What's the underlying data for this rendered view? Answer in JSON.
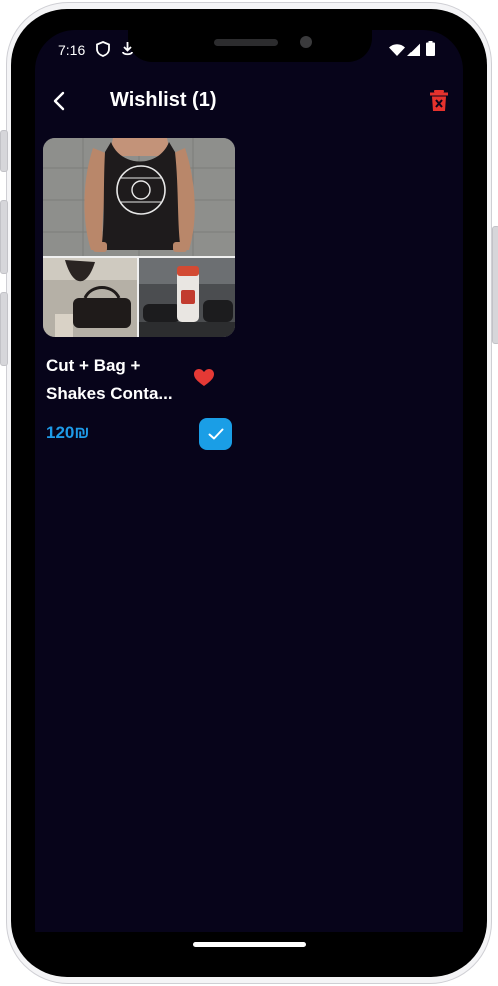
{
  "status_bar": {
    "time": "7:16",
    "left_icons": [
      "shield-icon",
      "download-notification-icon"
    ],
    "right_icons": [
      "wifi-icon",
      "signal-icon",
      "battery-icon"
    ]
  },
  "header": {
    "back_icon": "chevron-left-icon",
    "title": "Wishlist (1)",
    "delete_icon": "trash-icon",
    "delete_color": "#e5322d"
  },
  "wishlist": {
    "items": [
      {
        "name": "Cut + Bag + Shakes Conta...",
        "price": "120₪",
        "favorited": true,
        "selected": true,
        "heart_color": "#e53935",
        "price_color": "#1e9be8",
        "check_color": "#1a9ee6"
      }
    ]
  },
  "theme": {
    "background": "#07041a",
    "text": "#ffffff"
  }
}
